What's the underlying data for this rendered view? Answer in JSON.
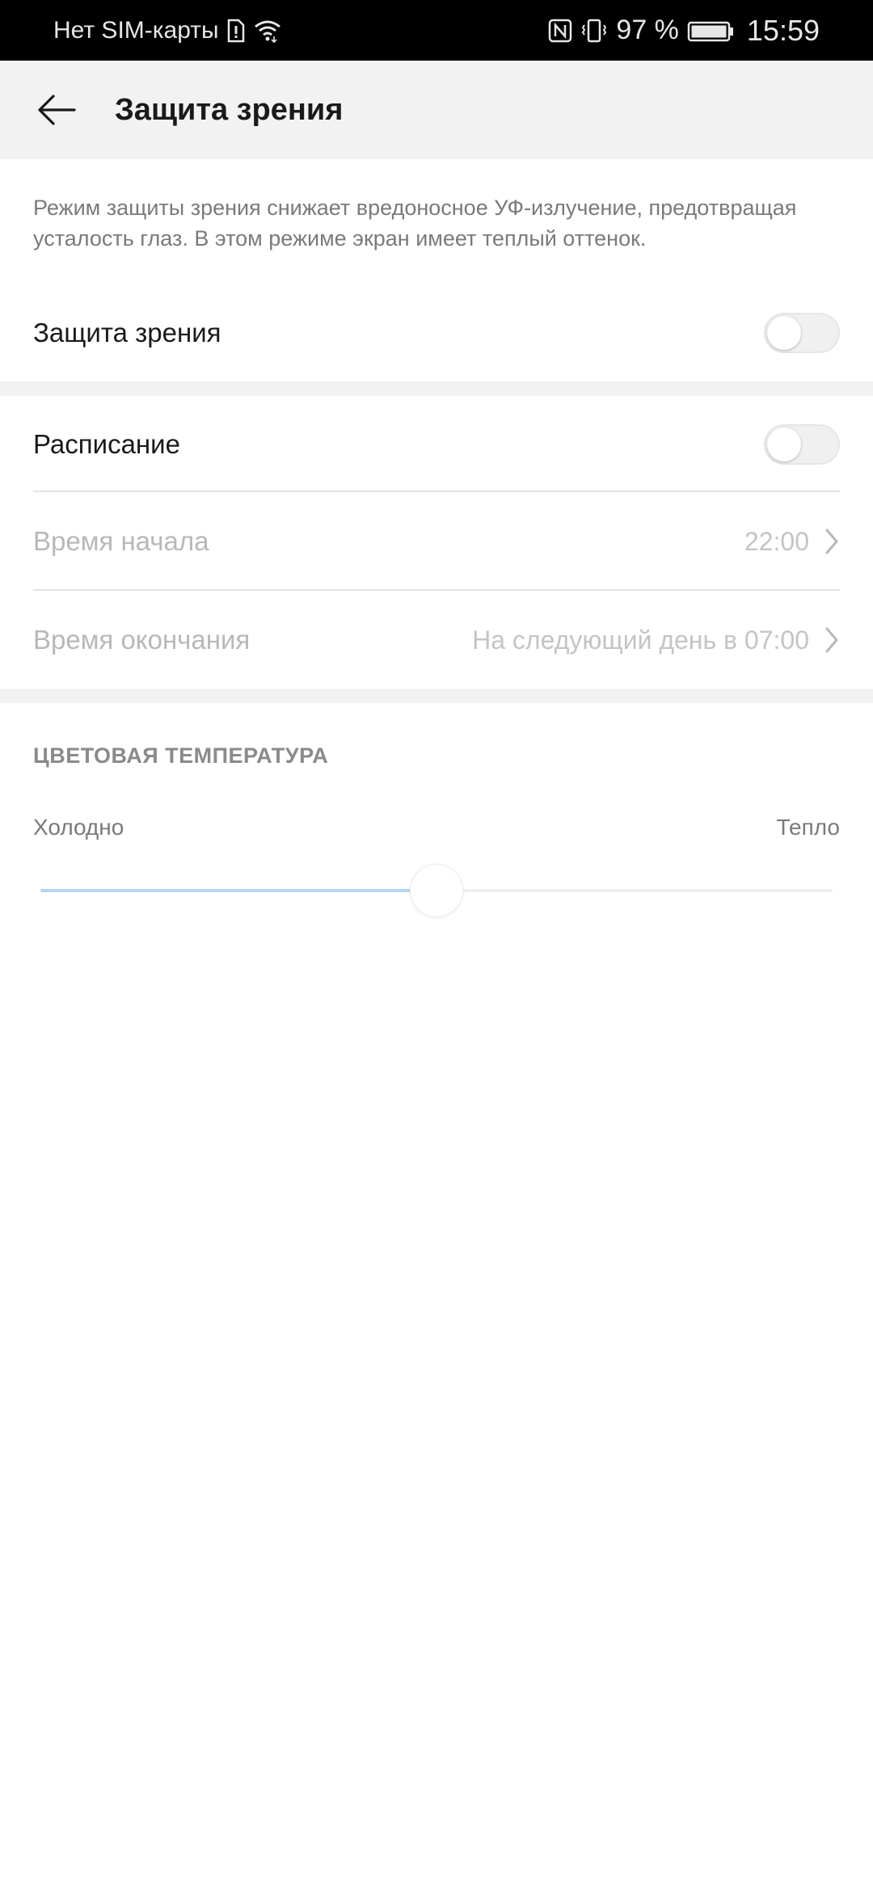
{
  "status_bar": {
    "carrier": "Нет SIM-карты",
    "battery_percent": "97 %",
    "time": "15:59",
    "icons": [
      "sim-alert-icon",
      "wifi-icon",
      "nfc-icon",
      "vibrate-icon",
      "battery-icon"
    ]
  },
  "app_bar": {
    "back_icon": "arrow-left-icon",
    "title": "Защита зрения"
  },
  "description": "Режим защиты зрения снижает вредоносное УФ-излучение, предотвращая усталость глаз. В этом режиме экран имеет теплый оттенок.",
  "eye_protection": {
    "label": "Защита зрения",
    "enabled": false
  },
  "schedule": {
    "label": "Расписание",
    "enabled": false,
    "start_time": {
      "label": "Время начала",
      "value": "22:00"
    },
    "end_time": {
      "label": "Время окончания",
      "value": "На следующий день в 07:00"
    }
  },
  "color_temperature": {
    "header": "ЦВЕТОВАЯ ТЕМПЕРАТУРА",
    "min_label": "Холодно",
    "max_label": "Тепло",
    "level_fraction": 0.5
  },
  "colors": {
    "status_bar_bg": "#000000",
    "app_bar_bg": "#f2f2f2",
    "slider_fill": "#b6d4f3",
    "text_primary": "#1a1a1a",
    "text_secondary": "#7a7a7a",
    "text_disabled": "#b8b8b8"
  }
}
